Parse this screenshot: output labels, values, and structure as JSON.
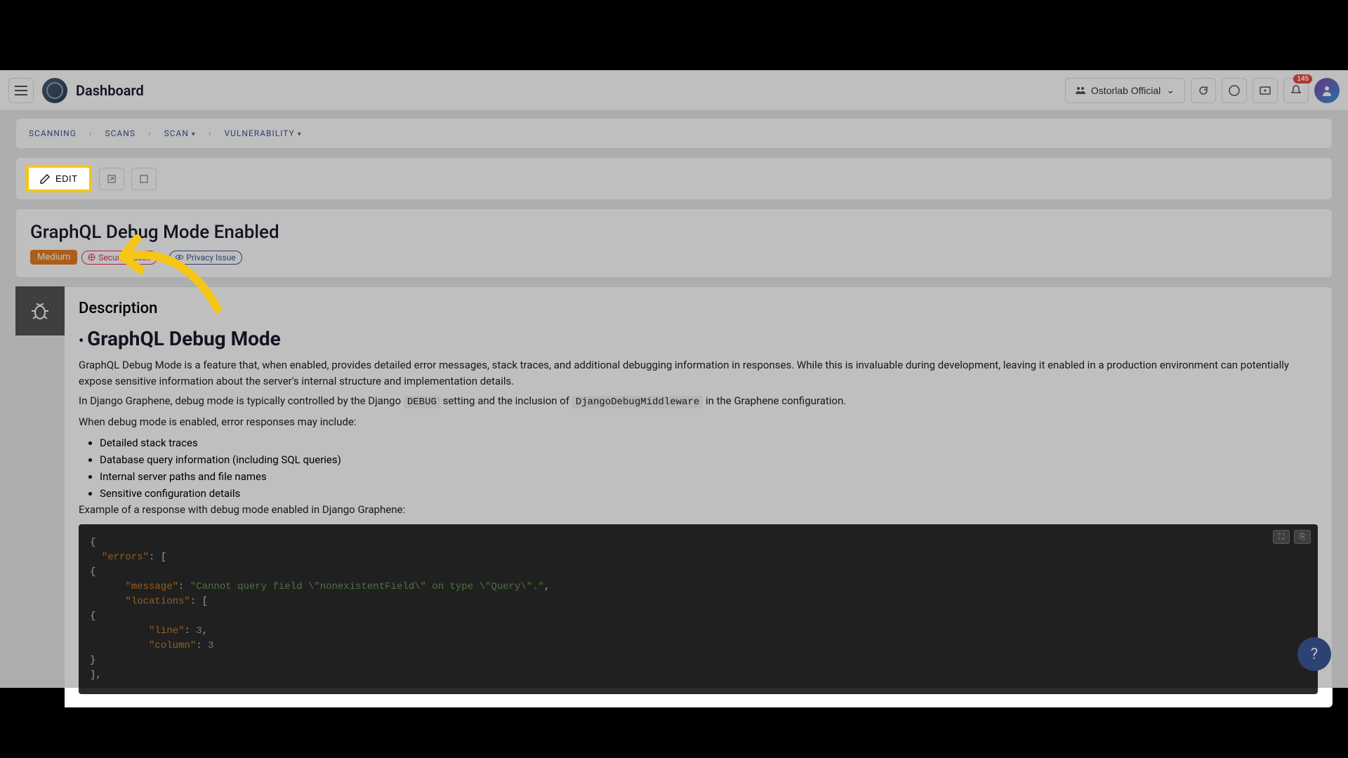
{
  "header": {
    "title": "Dashboard",
    "org_label": "Ostorlab Official",
    "notification_count": "145"
  },
  "breadcrumb": {
    "items": [
      "SCANNING",
      "SCANS",
      "SCAN",
      "VULNERABILITY"
    ]
  },
  "actions": {
    "edit_label": "EDIT"
  },
  "vulnerability": {
    "title": "GraphQL Debug Mode Enabled",
    "severity": "Medium",
    "tag_security": "Security Issue",
    "tag_privacy": "Privacy Issue"
  },
  "description": {
    "heading": "Description",
    "section_title": "GraphQL Debug Mode",
    "p1": "GraphQL Debug Mode is a feature that, when enabled, provides detailed error messages, stack traces, and additional debugging information in responses. While this is invaluable during development, leaving it enabled in a production environment can potentially expose sensitive information about the server's internal structure and implementation details.",
    "p2a": "In Django Graphene, debug mode is typically controlled by the Django ",
    "p2_code1": "DEBUG",
    "p2b": " setting and the inclusion of ",
    "p2_code2": "DjangoDebugMiddleware",
    "p2c": " in the Graphene configuration.",
    "p3": "When debug mode is enabled, error responses may include:",
    "bullets": [
      "Detailed stack traces",
      "Database query information (including SQL queries)",
      "Internal server paths and file names",
      "Sensitive configuration details"
    ],
    "p4": "Example of a response with debug mode enabled in Django Graphene:"
  },
  "code": {
    "l1": "{",
    "l2_k": "\"errors\"",
    "l2_r": ": [",
    "l3": "    {",
    "l4_k": "\"message\"",
    "l4_v": "\"Cannot query field \\\"nonexistentField\\\" on type \\\"Query\\\".\"",
    "l5_k": "\"locations\"",
    "l5_r": ": [",
    "l6": "        {",
    "l7_k": "\"line\"",
    "l7_v": "3",
    "l8_k": "\"column\"",
    "l8_v": "3",
    "l9": "        }",
    "l10": "      ],"
  },
  "help": {
    "label": "?"
  }
}
